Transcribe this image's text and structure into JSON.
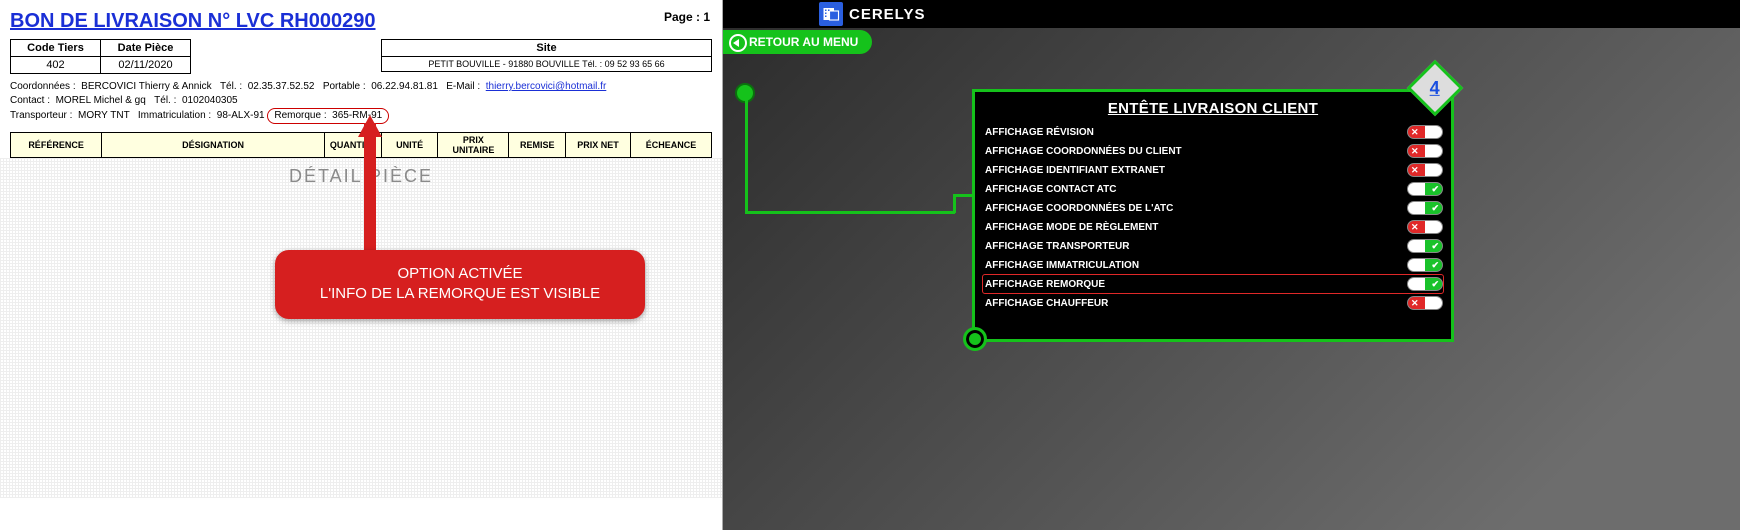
{
  "doc": {
    "title": "BON DE LIVRAISON N° LVC  RH000290",
    "page_label": "Page :",
    "page_number": "1",
    "table1": {
      "h1": "Code Tiers",
      "h2": "Date Pièce",
      "v1": "402",
      "v2": "02/11/2020"
    },
    "site": {
      "header": "Site",
      "value": "PETIT BOUVILLE - 91880 BOUVILLE Tél. : 09 52 93 65 66"
    },
    "coords_label": "Coordonnées :",
    "coords_name": "BERCOVICI Thierry & Annick",
    "tel_label": "Tél. :",
    "tel": "02.35.37.52.52",
    "portable_label": "Portable :",
    "portable": "06.22.94.81.81",
    "email_label": "E-Mail :",
    "email": "thierry.bercovici@hotmail.fr",
    "contact_label": "Contact :",
    "contact_name": "MOREL Michel & gq",
    "contact_tel": "0102040305",
    "transporteur_label": "Transporteur :",
    "transporteur": "MORY TNT",
    "immat_label": "Immatriculation :",
    "immat": "98-ALX-91",
    "remorque_label": "Remorque :",
    "remorque": "365-RM-91",
    "cols": [
      "RÉFÉRENCE",
      "DÉSIGNATION",
      "QUANTITÉ",
      "UNITÉ",
      "PRIX UNITAIRE",
      "REMISE",
      "PRIX NET",
      "ÉCHEANCE"
    ],
    "detail_label": "DÉTAIL PIÈCE",
    "callout_line1": "OPTION ACTIVÉE",
    "callout_line2": "L'INFO DE LA REMORQUE EST VISIBLE"
  },
  "app": {
    "brand": "CERELYS",
    "back": "RETOUR AU MENU",
    "panel_title": "ENTÊTE LIVRAISON CLIENT",
    "badge": "4",
    "options": [
      {
        "label": "AFFICHAGE RÉVISION",
        "on": false,
        "hl": false
      },
      {
        "label": "AFFICHAGE COORDONNÉES DU CLIENT",
        "on": false,
        "hl": false
      },
      {
        "label": "AFFICHAGE IDENTIFIANT EXTRANET",
        "on": false,
        "hl": false
      },
      {
        "label": "AFFICHAGE CONTACT ATC",
        "on": true,
        "hl": false
      },
      {
        "label": "AFFICHAGE COORDONNÉES DE L'ATC",
        "on": true,
        "hl": false
      },
      {
        "label": "AFFICHAGE MODE DE RÈGLEMENT",
        "on": false,
        "hl": false
      },
      {
        "label": "AFFICHAGE TRANSPORTEUR",
        "on": true,
        "hl": false
      },
      {
        "label": "AFFICHAGE IMMATRICULATION",
        "on": true,
        "hl": false
      },
      {
        "label": "AFFICHAGE REMORQUE",
        "on": true,
        "hl": true
      },
      {
        "label": "AFFICHAGE CHAUFFEUR",
        "on": false,
        "hl": false
      }
    ]
  }
}
